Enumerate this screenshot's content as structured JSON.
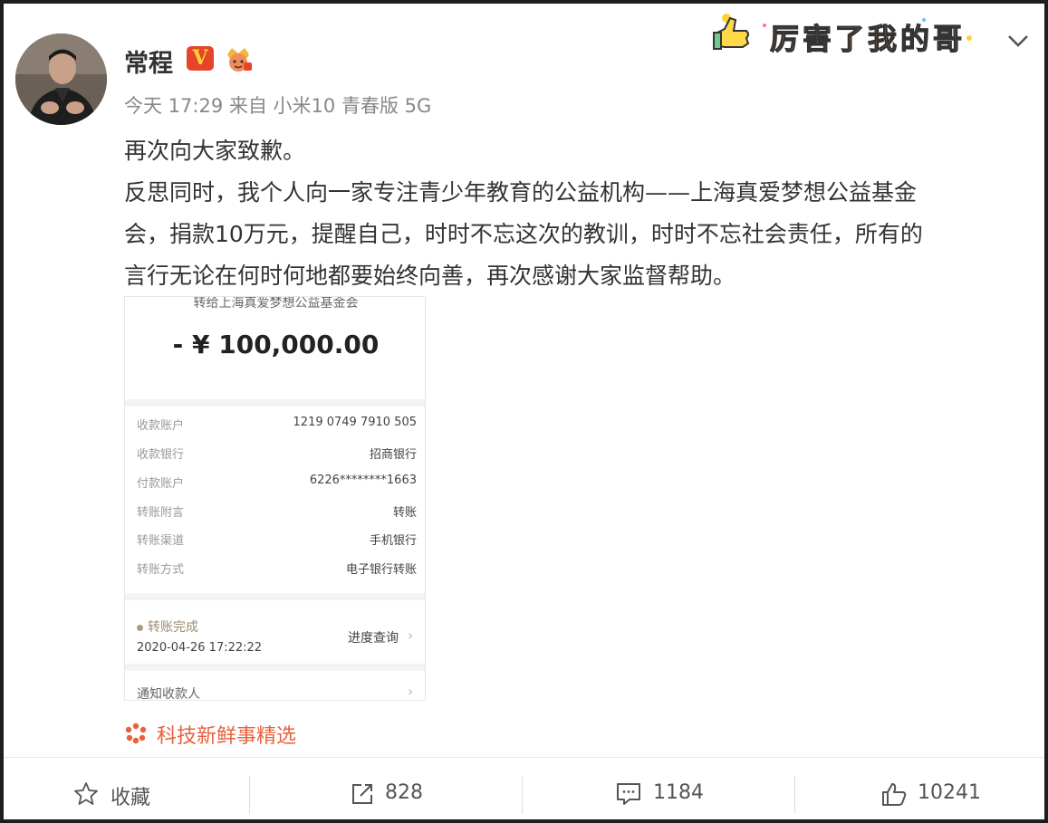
{
  "post": {
    "username": "常程",
    "verified_badge": "V",
    "timestamp_source": "今天 17:29 来自 小米10 青春版 5G",
    "lines": [
      "再次向大家致歉。",
      "反思同时，我个人向一家专注青少年教育的公益机构——上海真爱梦想公益基金",
      "会，捐款10万元，提醒自己，时时不忘这次的教训，时时不忘社会责任，所有的",
      "言行无论在何时何地都要始终向善，再次感谢大家监督帮助。"
    ],
    "sticker_text": "厉害了我的哥",
    "source_label": "科技新鲜事精选"
  },
  "receipt": {
    "recipient_title": "转给上海真爱梦想公益基金会",
    "amount": "- ¥ 100,000.00",
    "rows": [
      {
        "key": "收款账户",
        "value": "1219 0749 7910 505"
      },
      {
        "key": "收款银行",
        "value": "招商银行"
      },
      {
        "key": "付款账户",
        "value": "6226********1663"
      },
      {
        "key": "转账附言",
        "value": "转账"
      },
      {
        "key": "转账渠道",
        "value": "手机银行"
      },
      {
        "key": "转账方式",
        "value": "电子银行转账"
      }
    ],
    "status": "转账完成",
    "status_date": "2020-04-26 17:22:22",
    "progress_link": "进度查询",
    "notify_label": "通知收款人"
  },
  "actions": {
    "favorite_label": "收藏",
    "repost_count": "828",
    "comment_count": "1184",
    "like_count": "10241"
  },
  "icons": {
    "avatar": "avatar",
    "verified": "verified-badge-icon",
    "member": "crown-member-icon",
    "dropdown": "chevron-down-icon",
    "source": "flower-source-icon",
    "favorite": "star-icon",
    "repost": "share-icon",
    "comment": "comment-icon",
    "like": "thumbs-up-icon"
  },
  "colors": {
    "source_accent": "#e8613c",
    "verified_bg": "#e6452a",
    "verified_fg": "#ffd23a"
  }
}
